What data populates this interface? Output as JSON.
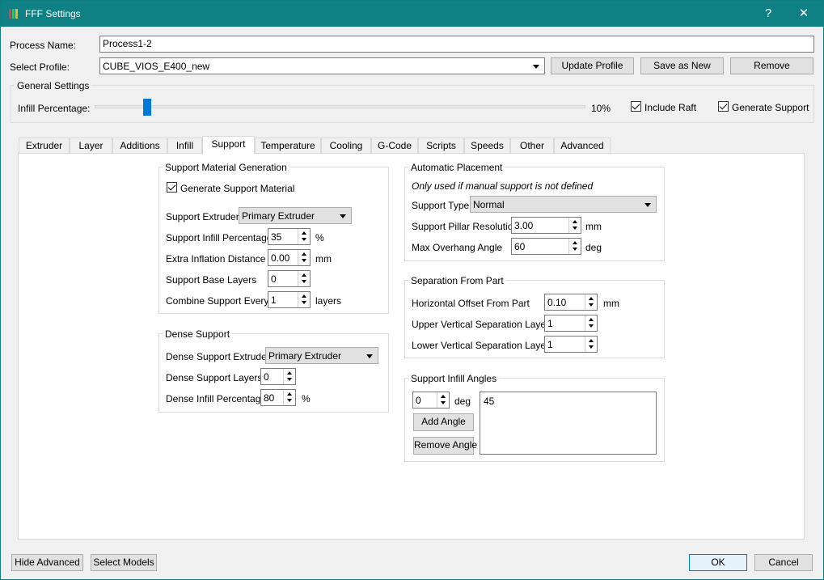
{
  "window": {
    "title": "FFF Settings",
    "help_label": "?",
    "close_label": "✕"
  },
  "process_name": {
    "label": "Process Name:",
    "value": "Process1-2"
  },
  "profile": {
    "label": "Select Profile:",
    "value": "CUBE_VIOS_E400_new",
    "update_label": "Update Profile",
    "save_as_label": "Save as New",
    "remove_label": "Remove"
  },
  "general": {
    "title": "General Settings",
    "infill_label": "Infill Percentage:",
    "infill_value_text": "10%",
    "infill_fraction": 0.1,
    "include_raft_label": "Include Raft",
    "include_raft_checked": true,
    "generate_support_label": "Generate Support",
    "generate_support_checked": true
  },
  "tabs": [
    "Extruder",
    "Layer",
    "Additions",
    "Infill",
    "Support",
    "Temperature",
    "Cooling",
    "G-Code",
    "Scripts",
    "Speeds",
    "Other",
    "Advanced"
  ],
  "active_tab": "Support",
  "support_material": {
    "title": "Support Material Generation",
    "generate_label": "Generate Support Material",
    "generate_checked": true,
    "extruder_label": "Support Extruder",
    "extruder_value": "Primary Extruder",
    "infill_label": "Support Infill Percentage",
    "infill_value": "35",
    "infill_unit": "%",
    "inflation_label": "Extra Inflation Distance",
    "inflation_value": "0.00",
    "inflation_unit": "mm",
    "base_layers_label": "Support Base Layers",
    "base_layers_value": "0",
    "combine_label": "Combine Support Every",
    "combine_value": "1",
    "combine_unit": "layers"
  },
  "dense_support": {
    "title": "Dense Support",
    "extruder_label": "Dense Support Extruder",
    "extruder_value": "Primary Extruder",
    "layers_label": "Dense Support Layers",
    "layers_value": "0",
    "infill_label": "Dense Infill Percentage",
    "infill_value": "80",
    "infill_unit": "%"
  },
  "automatic_placement": {
    "title": "Automatic Placement",
    "note": "Only used if manual support is not defined",
    "type_label": "Support Type",
    "type_value": "Normal",
    "pillar_label": "Support Pillar Resolution",
    "pillar_value": "3.00",
    "pillar_unit": "mm",
    "overhang_label": "Max Overhang Angle",
    "overhang_value": "60",
    "overhang_unit": "deg"
  },
  "separation": {
    "title": "Separation From Part",
    "horizontal_label": "Horizontal Offset From Part",
    "horizontal_value": "0.10",
    "horizontal_unit": "mm",
    "upper_label": "Upper Vertical Separation Layers",
    "upper_value": "1",
    "lower_label": "Lower Vertical Separation Layers",
    "lower_value": "1"
  },
  "infill_angles": {
    "title": "Support Infill Angles",
    "angle_value": "0",
    "angle_unit": "deg",
    "add_label": "Add Angle",
    "remove_label": "Remove Angle",
    "list": [
      "45"
    ]
  },
  "footer": {
    "hide_advanced_label": "Hide Advanced",
    "select_models_label": "Select Models",
    "ok_label": "OK",
    "cancel_label": "Cancel"
  }
}
